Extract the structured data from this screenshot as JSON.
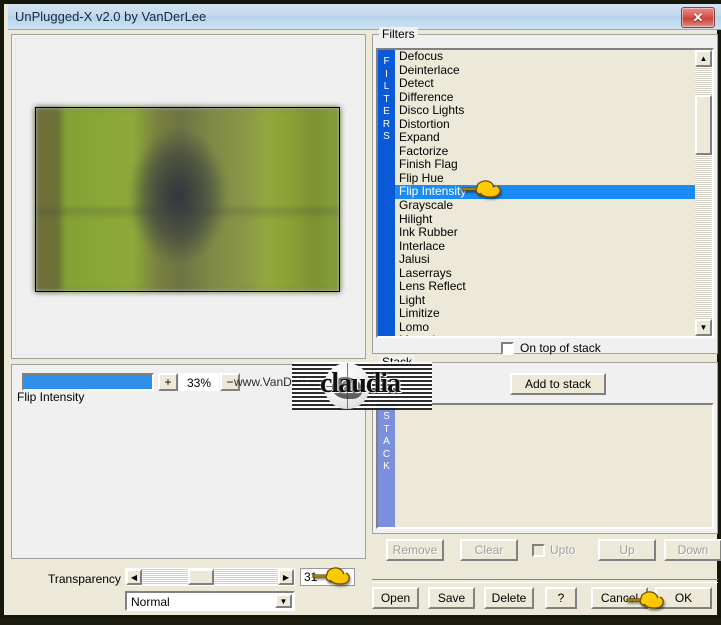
{
  "window": {
    "title": "UnPlugged-X v2.0 by VanDerLee",
    "close_icon": "close-x-icon",
    "close_label": "✕"
  },
  "preview": {
    "name": "filter-preview-image"
  },
  "effect": {
    "group_label": "Flip Intensity",
    "percent": "33%",
    "plus_label": "+",
    "minus_label": "−",
    "site_url": "www.VanDerLee.com",
    "progress_percent": 100
  },
  "transparency": {
    "label": "Transparency",
    "value": "31",
    "left_arrow": "◀",
    "right_arrow": "▶",
    "blend_mode": "Normal",
    "blend_arrow": "▼"
  },
  "filters": {
    "group_label": "Filters",
    "sidebar_text": "FILTERS",
    "selected": "Flip Intensity",
    "items": [
      "Defocus",
      "Deinterlace",
      "Detect",
      "Difference",
      "Disco Lights",
      "Distortion",
      "Expand",
      "Factorize",
      "Finish Flag",
      "Flip Hue",
      "Flip Intensity",
      "Grayscale",
      "Hilight",
      "Ink Rubber",
      "Interlace",
      "Jalusi",
      "Laserrays",
      "Lens Reflect",
      "Light",
      "Limitize",
      "Lomo",
      "Monotize"
    ],
    "scroll_up": "▲",
    "scroll_down": "▼",
    "on_top_of_stack": "On top of stack",
    "on_top_checked": false
  },
  "stack": {
    "group_label": "Stack",
    "sidebar_text": "STACK",
    "add_button": "Add to stack",
    "items": [],
    "buttons": {
      "remove": "Remove",
      "clear": "Clear",
      "upto": "Upto",
      "upto_checked": false,
      "up": "Up",
      "down": "Down"
    }
  },
  "bottom": {
    "open": "Open",
    "save": "Save",
    "delete": "Delete",
    "help": "?",
    "cancel": "Cancel",
    "ok": "OK"
  },
  "watermark": {
    "text": "claudia"
  },
  "colors": {
    "accent_blue": "#0a5ad8",
    "selection_blue": "#1a8bf5",
    "progress_blue": "#2f8fe8",
    "stack_bar_blue": "#7b8fdc",
    "close_red": "#d9564f",
    "panel": "#f0f0f0",
    "list_bg": "#ece9d8",
    "window_border": "#14170a"
  }
}
